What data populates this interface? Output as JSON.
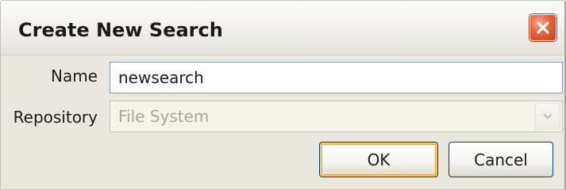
{
  "window": {
    "title": "Create New Search",
    "close_icon": "close-x-icon"
  },
  "form": {
    "name_label": "Name",
    "name_value": "newsearch",
    "repository_label": "Repository",
    "repository_value": "File System",
    "repository_dropdown_icon": "chevron-down-icon"
  },
  "buttons": {
    "ok_label": "OK",
    "cancel_label": "Cancel"
  },
  "colors": {
    "close_button": "#d9532c",
    "window_background": "#eae7df",
    "default_button_focus": "#f9c869",
    "disabled_text": "#aca899"
  }
}
